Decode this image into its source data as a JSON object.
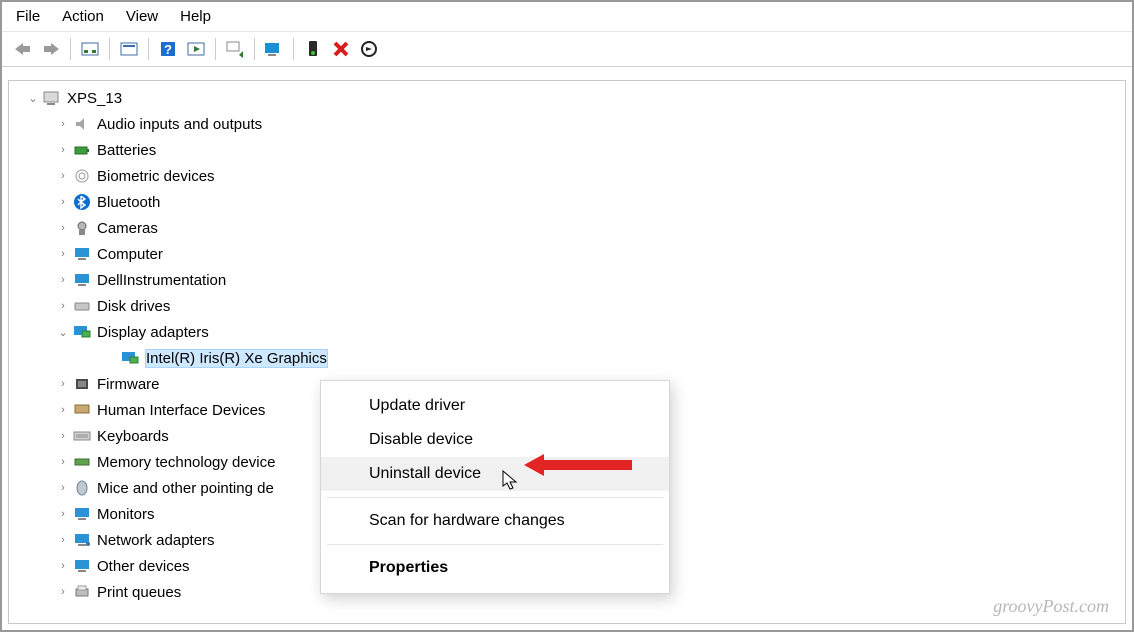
{
  "menubar": {
    "items": [
      "File",
      "Action",
      "View",
      "Help"
    ]
  },
  "tree": {
    "root": "XPS_13",
    "items": [
      {
        "label": "Audio inputs and outputs",
        "expand": ">"
      },
      {
        "label": "Batteries",
        "expand": ">"
      },
      {
        "label": "Biometric devices",
        "expand": ">"
      },
      {
        "label": "Bluetooth",
        "expand": ">"
      },
      {
        "label": "Cameras",
        "expand": ">"
      },
      {
        "label": "Computer",
        "expand": ">"
      },
      {
        "label": "DellInstrumentation",
        "expand": ">"
      },
      {
        "label": "Disk drives",
        "expand": ">"
      },
      {
        "label": "Display adapters",
        "expand": "v",
        "child": {
          "label": "Intel(R) Iris(R) Xe Graphics",
          "selected": true
        }
      },
      {
        "label": "Firmware",
        "expand": ">"
      },
      {
        "label": "Human Interface Devices",
        "expand": ">"
      },
      {
        "label": "Keyboards",
        "expand": ">"
      },
      {
        "label": "Memory technology device",
        "expand": ">"
      },
      {
        "label": "Mice and other pointing de",
        "expand": ">"
      },
      {
        "label": "Monitors",
        "expand": ">"
      },
      {
        "label": "Network adapters",
        "expand": ">"
      },
      {
        "label": "Other devices",
        "expand": ">"
      },
      {
        "label": "Print queues",
        "expand": ">"
      }
    ]
  },
  "context_menu": {
    "items": [
      {
        "label": "Update driver"
      },
      {
        "label": "Disable device"
      },
      {
        "label": "Uninstall device",
        "hover": true
      },
      {
        "sep": true
      },
      {
        "label": "Scan for hardware changes"
      },
      {
        "sep": true
      },
      {
        "label": "Properties",
        "bold": true
      }
    ]
  },
  "watermark": "groovyPost.com"
}
